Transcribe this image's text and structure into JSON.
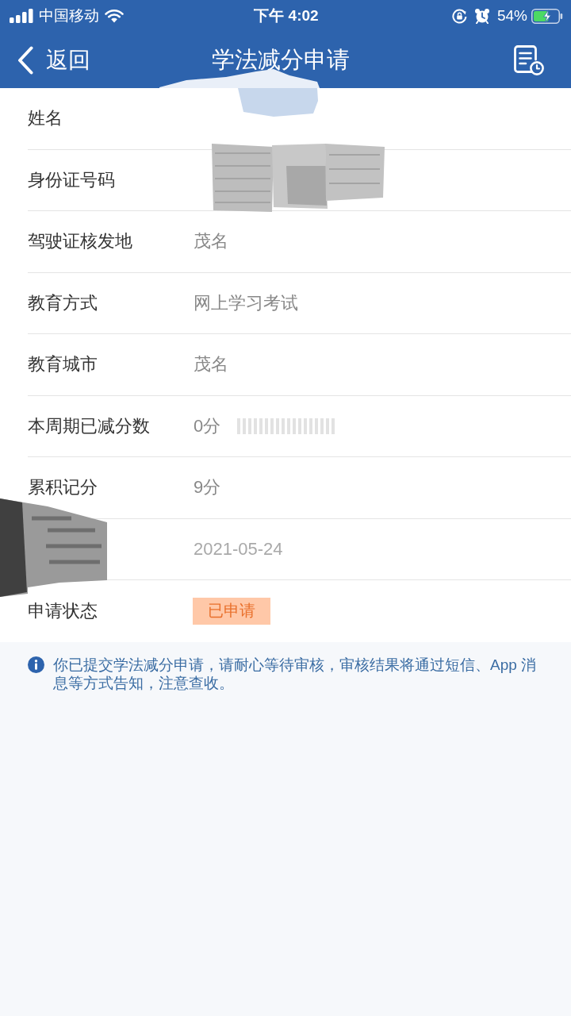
{
  "status_bar": {
    "carrier": "中国移动",
    "time": "下午 4:02",
    "battery": "54%"
  },
  "nav_bar": {
    "back_label": "返回",
    "title": "学法减分申请"
  },
  "form_rows": [
    {
      "label": "姓名",
      "kind": "smudge"
    },
    {
      "label": "身份证号码",
      "kind": "scribble"
    },
    {
      "label": "驾驶证核发地",
      "value": "茂名",
      "kind": "text"
    },
    {
      "label": "教育方式",
      "value": "网上学习考试",
      "kind": "text"
    },
    {
      "label": "教育城市",
      "value": "茂名",
      "kind": "text"
    },
    {
      "label": "本周期已减分数",
      "value": "0分",
      "kind": "text",
      "masked": true
    },
    {
      "label": "累积记分",
      "value": "9分",
      "kind": "text"
    },
    {
      "value": "2021-05-24",
      "kind": "label_scribble"
    },
    {
      "label": "申请状态",
      "value": "已申请",
      "kind": "badge"
    }
  ],
  "info_note": {
    "text": "你已提交学法减分申请，请耐心等待审核，审核结果将通过短信、App 消息等方式告知，注意查收。"
  }
}
